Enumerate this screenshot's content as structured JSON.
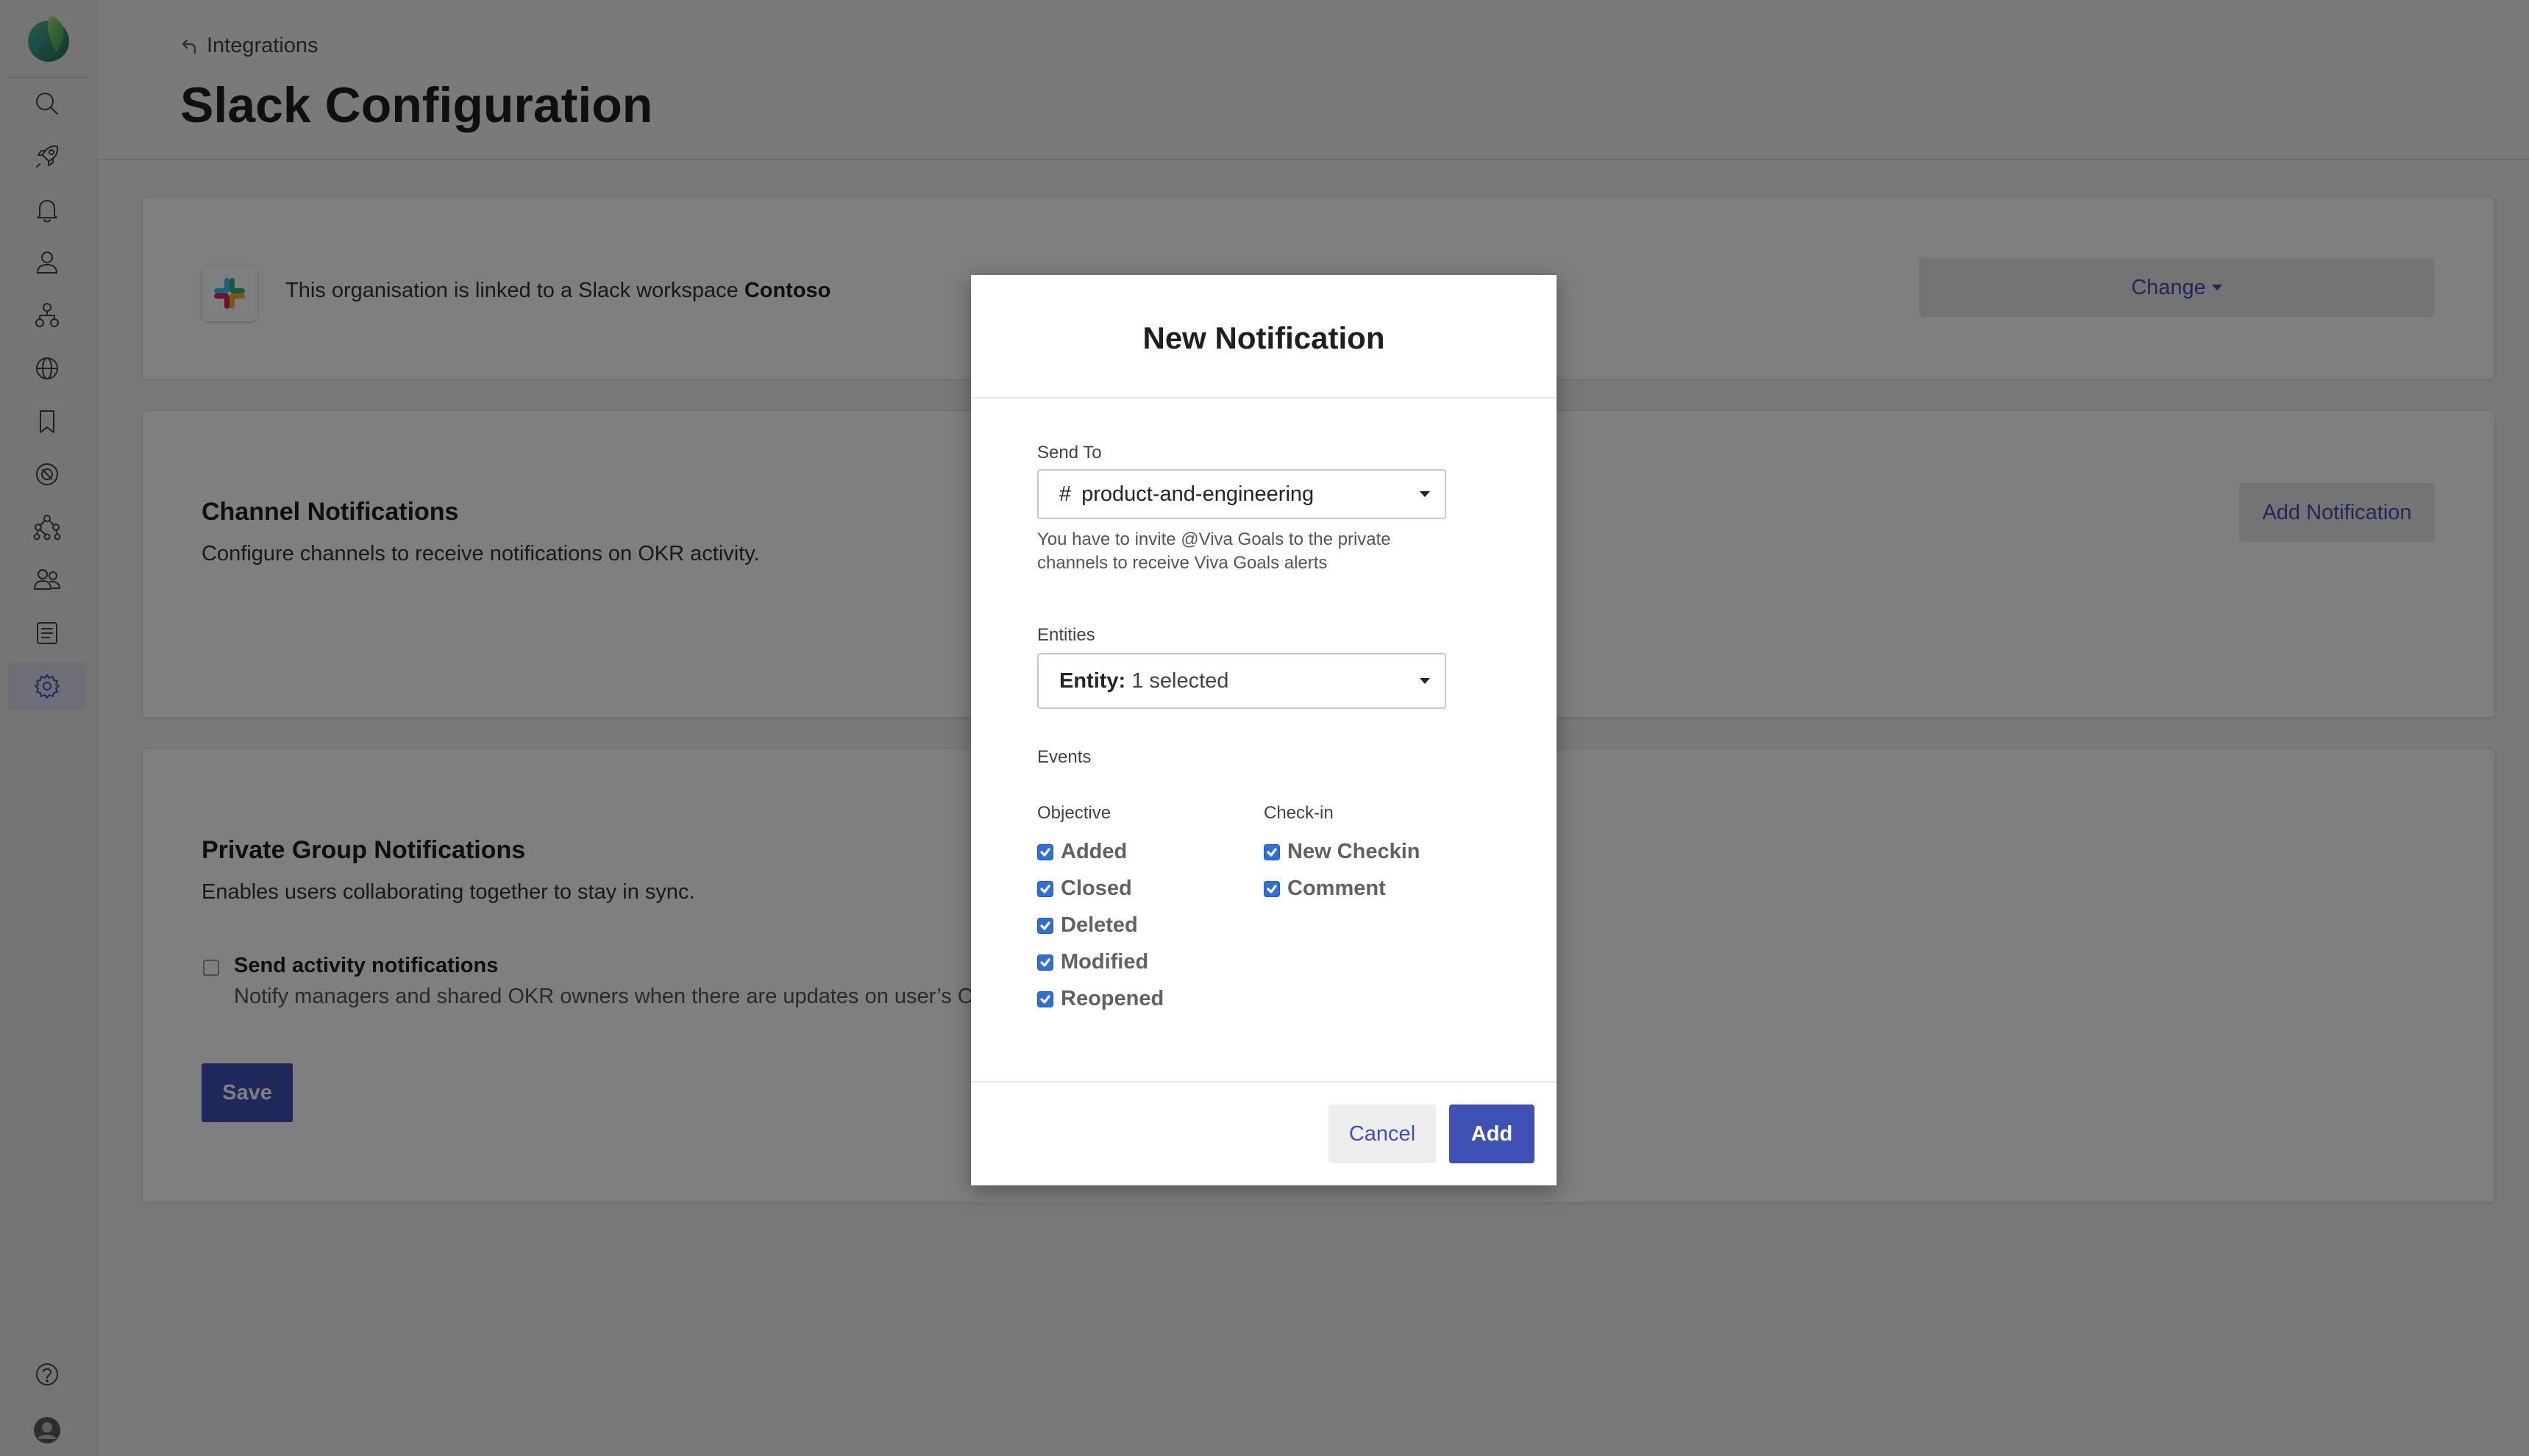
{
  "nav": {
    "items": [
      {
        "icon": "search-icon"
      },
      {
        "icon": "rocket-icon"
      },
      {
        "icon": "bell-icon"
      },
      {
        "icon": "person-icon"
      },
      {
        "icon": "org-chart-icon"
      },
      {
        "icon": "globe-icon"
      },
      {
        "icon": "bookmark-icon"
      },
      {
        "icon": "dial-icon"
      },
      {
        "icon": "hierarchy-icon"
      },
      {
        "icon": "people-icon"
      },
      {
        "icon": "list-icon"
      },
      {
        "icon": "gear-icon"
      }
    ],
    "bottom": [
      {
        "icon": "help-icon"
      },
      {
        "icon": "avatar"
      }
    ]
  },
  "header": {
    "breadcrumb": "Integrations",
    "title": "Slack Configuration"
  },
  "workspace": {
    "prefix": "This organisation is linked to a Slack workspace ",
    "name": "Contoso",
    "change_label": "Change"
  },
  "channel_notifications": {
    "title": "Channel Notifications",
    "description": "Configure channels to receive notifications on OKR activity.",
    "add_label": "Add Notification"
  },
  "private_group": {
    "title": "Private Group Notifications",
    "description": "Enables users collaborating together to stay in sync.",
    "option_label": "Send activity notifications",
    "option_desc": "Notify managers and shared OKR owners when there are updates on user’s OKRs.",
    "option_checked": false,
    "save_label": "Save"
  },
  "modal": {
    "title": "New Notification",
    "send_to_label": "Send To",
    "channel_prefix": "#",
    "channel": "product-and-engineering",
    "hint": "You have to invite @Viva Goals to the private channels to receive Viva Goals alerts",
    "entities_label": "Entities",
    "entity_key": "Entity:",
    "entity_value": "1 selected",
    "events_label": "Events",
    "objective_label": "Objective",
    "objective_events": [
      "Added",
      "Closed",
      "Deleted",
      "Modified",
      "Reopened"
    ],
    "checkin_label": "Check-in",
    "checkin_events": [
      "New Checkin",
      "Comment"
    ],
    "cancel_label": "Cancel",
    "add_label": "Add"
  },
  "colors": {
    "accent": "#3f51b5",
    "checkbox": "#2f6fd6",
    "overlay": "rgba(0,0,0,0.5)"
  }
}
